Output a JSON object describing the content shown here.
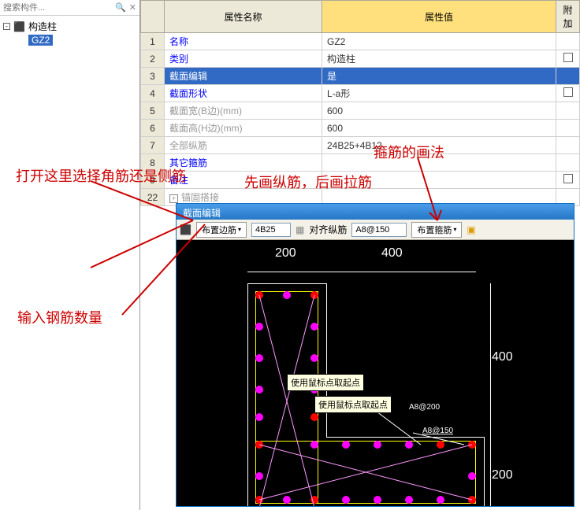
{
  "left_panel": {
    "search_placeholder": "搜索构件...",
    "tree_root": "构造柱",
    "tree_child": "GZ2"
  },
  "prop_table": {
    "headers": {
      "name": "属性名称",
      "value": "属性值",
      "extra": "附加"
    },
    "rows": [
      {
        "num": "1",
        "name": "名称",
        "value": "GZ2",
        "extra": "",
        "name_style": "blue",
        "selected": false
      },
      {
        "num": "2",
        "name": "类别",
        "value": "构造柱",
        "extra": "check",
        "name_style": "blue",
        "selected": false
      },
      {
        "num": "3",
        "name": "截面编辑",
        "value": "是",
        "extra": "",
        "name_style": "blue",
        "selected": true
      },
      {
        "num": "4",
        "name": "截面形状",
        "value": "L-a形",
        "extra": "check",
        "name_style": "blue",
        "selected": false
      },
      {
        "num": "5",
        "name": "截面宽(B边)(mm)",
        "value": "600",
        "extra": "",
        "name_style": "gray",
        "selected": false
      },
      {
        "num": "6",
        "name": "截面高(H边)(mm)",
        "value": "600",
        "extra": "",
        "name_style": "gray",
        "selected": false
      },
      {
        "num": "7",
        "name": "全部纵筋",
        "value": "24B25+4B12",
        "extra": "",
        "name_style": "gray",
        "selected": false
      },
      {
        "num": "8",
        "name": "其它箍筋",
        "value": "",
        "extra": "",
        "name_style": "blue",
        "selected": false
      },
      {
        "num": "9",
        "name": "备注",
        "value": "",
        "extra": "check",
        "name_style": "blue",
        "selected": false
      },
      {
        "num": "22",
        "name": "锚固搭接",
        "value": "",
        "extra": "",
        "name_style": "gray",
        "selected": false,
        "expandable": true
      }
    ]
  },
  "annotations": {
    "a1": "打开这里选择角筋还是侧筋",
    "a2": "先画纵筋，后画拉筋",
    "a3": "箍筋的画法",
    "a4": "输入钢筋数量"
  },
  "section_editor": {
    "title": "截面编辑",
    "toolbar": {
      "btn1": "布置边筋",
      "input1": "4B25",
      "btn2": "对齐纵筋",
      "input2": "A8@150",
      "btn3": "布置箍筋"
    },
    "dims": {
      "d200": "200",
      "d400a": "400",
      "d400b": "400",
      "d200b": "200"
    },
    "tooltips": {
      "t1": "使用鼠标点取起点",
      "t2": "使用鼠标点取起点"
    },
    "labels": {
      "l1": "A8@200",
      "l2": "A8@150"
    }
  }
}
